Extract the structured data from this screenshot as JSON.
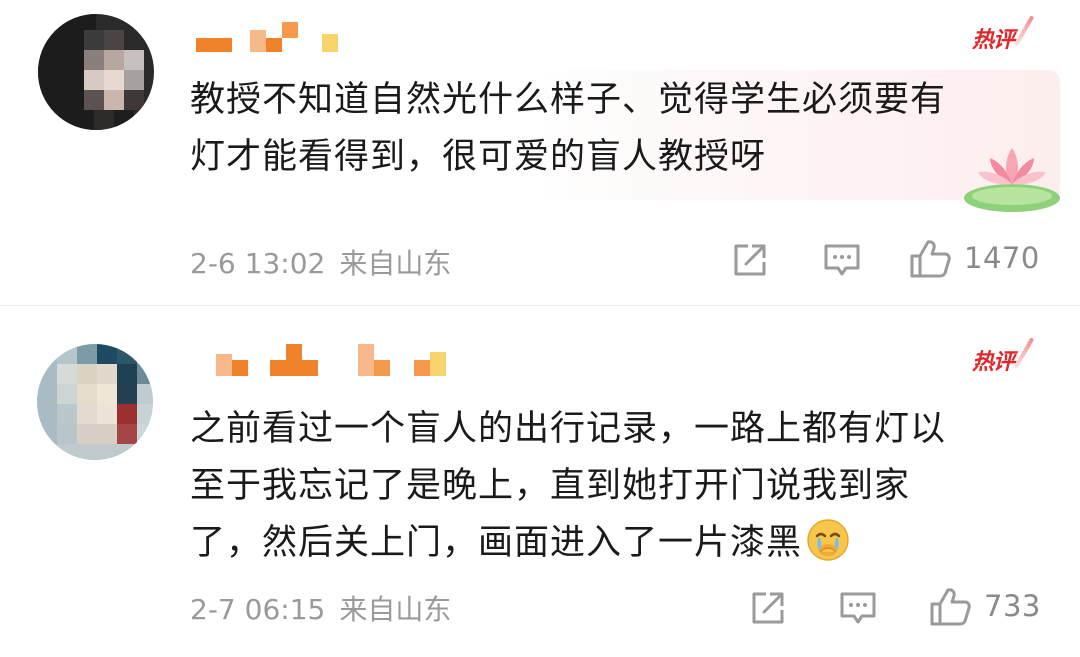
{
  "comments": [
    {
      "badge": "热评",
      "content_lines": [
        "教授不知道自然光什么样子、觉得学生必须要有",
        "灯才能看得到，很可爱的盲人教授呀"
      ],
      "time": "2-6 13:02",
      "location": "来自山东",
      "likes": "1470",
      "decoration": "lotus-sticker"
    },
    {
      "badge": "热评",
      "content_lines": [
        "之前看过一个盲人的出行记录，一路上都有灯以",
        "至于我忘记了是晚上，直到她打开门说我到家",
        "了，然后关上门，画面进入了一片漆黑"
      ],
      "inline_emoji": "crying-face-emoji",
      "time": "2-7 06:15",
      "location": "来自山东",
      "likes": "733"
    }
  ],
  "icons": {
    "share": "share-icon",
    "reply": "comment-icon",
    "like": "thumbs-up-icon"
  },
  "colors": {
    "hot_badge": "#e0272b",
    "username_orange": "#f0822a",
    "meta_gray": "#9a9a9a",
    "text": "#1a1a1a"
  }
}
